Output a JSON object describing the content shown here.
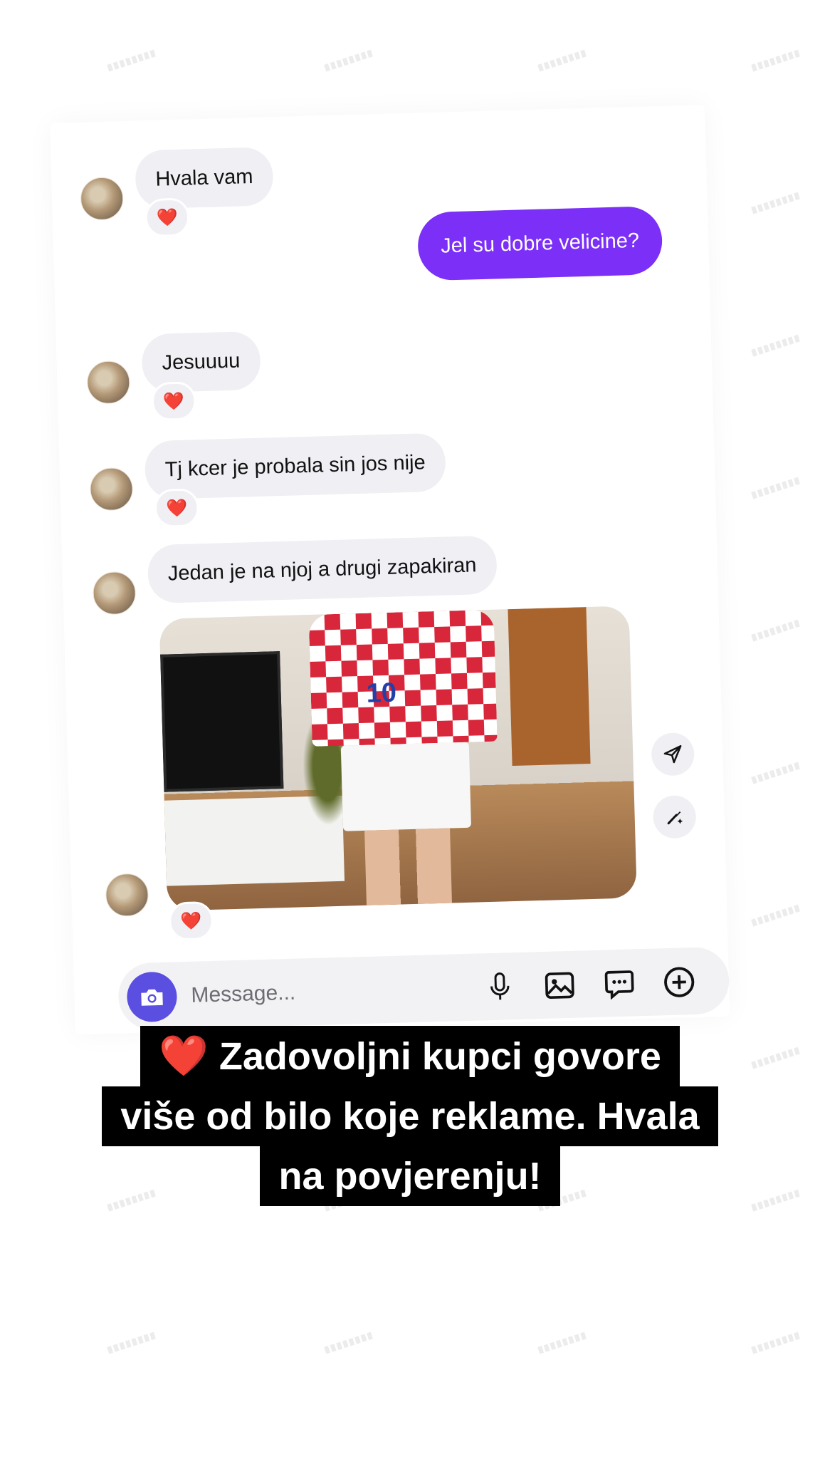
{
  "messages": [
    {
      "side": "in",
      "text": "Hvala vam",
      "reaction": "❤️"
    },
    {
      "side": "out",
      "text": "Jel su dobre velicine?"
    },
    {
      "side": "in",
      "text": "Jesuuuu",
      "reaction": "❤️"
    },
    {
      "side": "in",
      "text": "Tj kcer je probala sin  jos nije",
      "reaction": "❤️"
    },
    {
      "side": "in",
      "text": "Jedan je na njoj a drugi zapakiran"
    }
  ],
  "photo": {
    "reaction": "❤️",
    "jersey_number": "10"
  },
  "composer": {
    "placeholder": "Message..."
  },
  "icons": {
    "send_photo": "paper-plane-icon",
    "edit_photo": "brush-sparkle-icon",
    "camera": "camera-icon",
    "mic": "microphone-icon",
    "gallery": "image-icon",
    "chat_bubble": "chat-dots-icon",
    "add": "plus-circle-icon"
  },
  "caption": {
    "emoji": "❤️",
    "line1": "Zadovoljni kupci govore",
    "line2": "više od bilo koje reklame. Hvala",
    "line3": "na povjerenju!"
  },
  "colors": {
    "outgoing_bubble": "#7b2ff7",
    "incoming_bubble": "#efeff4",
    "camera_button": "#5a4fe0",
    "caption_bg": "#000000"
  }
}
